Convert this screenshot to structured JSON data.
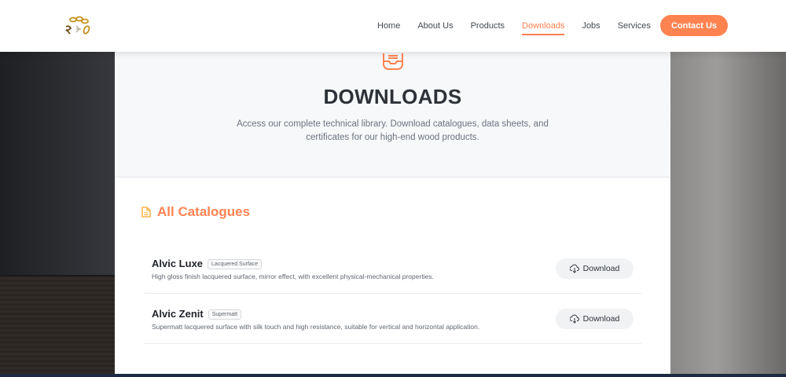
{
  "header": {
    "nav": [
      {
        "label": "Home",
        "active": false
      },
      {
        "label": "About Us",
        "active": false
      },
      {
        "label": "Products",
        "active": false
      },
      {
        "label": "Downloads",
        "active": true
      },
      {
        "label": "Jobs",
        "active": false
      },
      {
        "label": "Services",
        "active": false
      }
    ],
    "contact_label": "Contact Us",
    "logo_icon": "brand-logo-icon"
  },
  "hero": {
    "icon": "inbox-tray-icon",
    "title": "DOWNLOADS",
    "description": "Access our complete technical library. Download catalogues, data sheets, and certificates for our high-end wood products."
  },
  "section": {
    "icon": "document-icon",
    "title": "All Catalogues"
  },
  "catalogues": [
    {
      "name": "Alvic Luxe",
      "badge": "Lacquered Surface",
      "description": "High gloss finish lacquered surface, mirror effect, with excellent physical-mechanical properties.",
      "button_label": "Download"
    },
    {
      "name": "Alvic Zenit",
      "badge": "Supermatt",
      "description": "Supermatt lacquered surface with silk touch and high resistance, suitable for vertical and horizontal application.",
      "button_label": "Download"
    }
  ],
  "colors": {
    "accent": "#ff8350",
    "title": "#2d3238",
    "muted": "#6b7280"
  }
}
